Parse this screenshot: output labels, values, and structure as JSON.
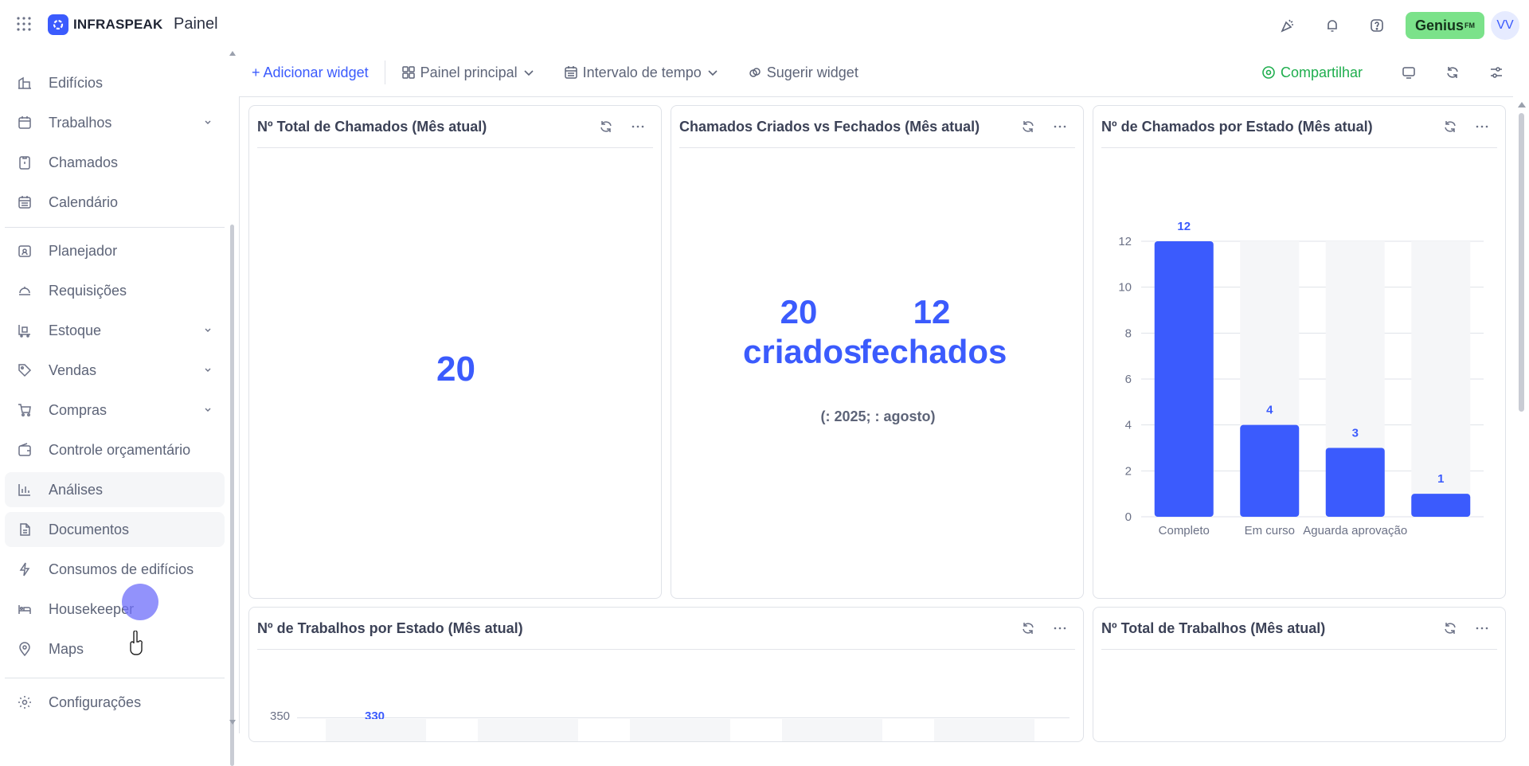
{
  "header": {
    "logo_text": "INFRASPEAK",
    "page_title": "Painel",
    "genius_label": "Genius",
    "genius_sup": "FM",
    "avatar_initials": "VV",
    "brand_color": "#3b5bfd"
  },
  "sidebar": {
    "items": [
      {
        "label": "Edifícios",
        "icon": "building-icon"
      },
      {
        "label": "Trabalhos",
        "icon": "calendar-check-icon",
        "expandable": true
      },
      {
        "label": "Chamados",
        "icon": "clipboard-icon"
      },
      {
        "label": "Calendário",
        "icon": "calendar-icon"
      },
      {
        "label": "Planejador",
        "icon": "planner-icon"
      },
      {
        "label": "Requisições",
        "icon": "bell-service-icon"
      },
      {
        "label": "Estoque",
        "icon": "stock-icon",
        "expandable": true
      },
      {
        "label": "Vendas",
        "icon": "tag-icon",
        "expandable": true
      },
      {
        "label": "Compras",
        "icon": "cart-icon",
        "expandable": true
      },
      {
        "label": "Controle orçamentário",
        "icon": "wallet-icon"
      },
      {
        "label": "Análises",
        "icon": "bar-chart-icon"
      },
      {
        "label": "Documentos",
        "icon": "document-icon"
      },
      {
        "label": "Consumos de edifícios",
        "icon": "lightning-icon"
      },
      {
        "label": "Housekeeper",
        "icon": "bed-icon"
      },
      {
        "label": "Maps",
        "icon": "map-pin-icon"
      },
      {
        "label": "Configurações",
        "icon": "gear-icon"
      }
    ]
  },
  "toolbar": {
    "add_widget": "+ Adicionar widget",
    "main_panel": "Painel principal",
    "time_range": "Intervalo de tempo",
    "suggest_widget": "Sugerir widget",
    "share": "Compartilhar"
  },
  "widgets": {
    "total_tickets": {
      "title": "Nº Total de Chamados (Mês atual)",
      "value": "20"
    },
    "created_vs_closed": {
      "title": "Chamados Criados vs Fechados (Mês atual)",
      "created_value": "20",
      "created_label": "criados",
      "closed_value": "12",
      "closed_label": "fechados",
      "note": "(: 2025; : agosto)"
    },
    "tickets_by_state": {
      "title": "Nº de Chamados por Estado (Mês atual)"
    },
    "jobs_by_state": {
      "title": "Nº de Trabalhos por Estado (Mês atual)",
      "first_value_label": "330",
      "y_top_tick": "350"
    },
    "total_jobs": {
      "title": "Nº Total de Trabalhos (Mês atual)"
    }
  },
  "chart_data": {
    "type": "bar",
    "categories": [
      "Completo",
      "Em curso",
      "Aguarda aprovação",
      ""
    ],
    "values": [
      12,
      4,
      3,
      1
    ],
    "ylim": [
      0,
      12
    ],
    "yticks": [
      0,
      2,
      4,
      6,
      8,
      10,
      12
    ],
    "bar_color": "#3b5bfd",
    "track_color": "#f5f6f8"
  }
}
